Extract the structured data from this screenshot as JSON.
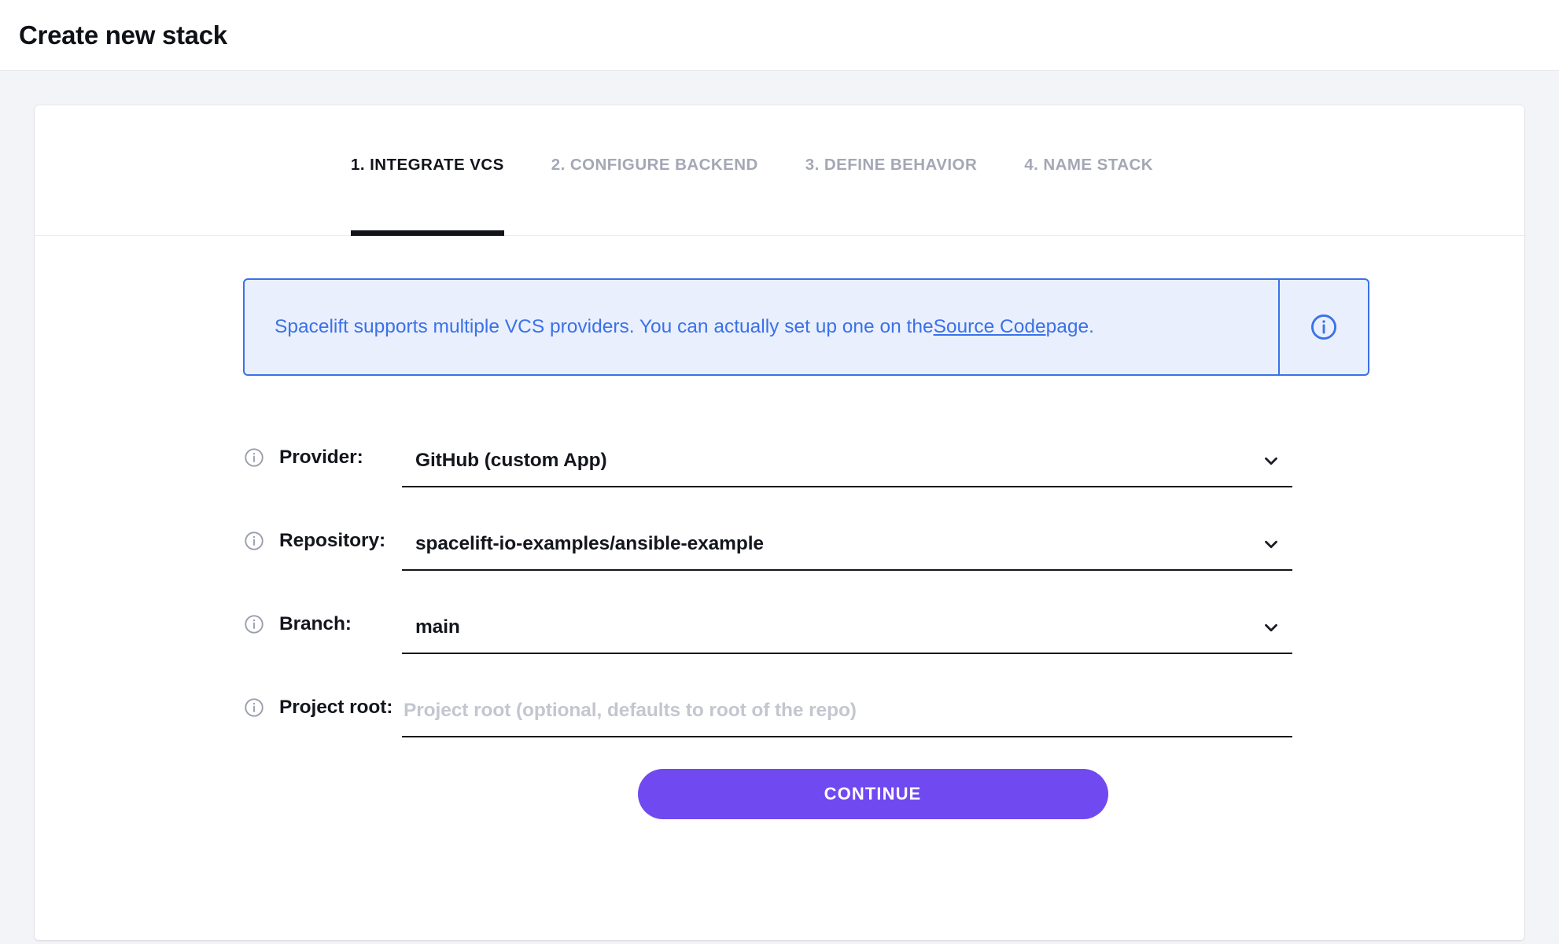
{
  "header": {
    "title": "Create new stack"
  },
  "wizard": {
    "tabs": [
      {
        "label": "1. INTEGRATE VCS",
        "active": true
      },
      {
        "label": "2. CONFIGURE BACKEND",
        "active": false
      },
      {
        "label": "3. DEFINE BEHAVIOR",
        "active": false
      },
      {
        "label": "4. NAME STACK",
        "active": false
      }
    ]
  },
  "banner": {
    "text_before": "Spacelift supports multiple VCS providers. You can actually set up one on the ",
    "link_text": "Source Code",
    "text_after": " page.",
    "icon": "info-circle-icon",
    "border_color": "#3b71e8",
    "background_color": "#e9effd",
    "text_color": "#3b71e8"
  },
  "form": {
    "fields": [
      {
        "label": "Provider:",
        "value": "GitHub (custom App)",
        "placeholder": "",
        "type": "select",
        "info_icon": "info-circle-icon",
        "chevron_icon": "chevron-down-icon"
      },
      {
        "label": "Repository:",
        "value": "spacelift-io-examples/ansible-example",
        "placeholder": "",
        "type": "select",
        "info_icon": "info-circle-icon",
        "chevron_icon": "chevron-down-icon"
      },
      {
        "label": "Branch:",
        "value": "main",
        "placeholder": "",
        "type": "select",
        "info_icon": "info-circle-icon",
        "chevron_icon": "chevron-down-icon"
      },
      {
        "label": "Project root:",
        "value": "",
        "placeholder": "Project root (optional, defaults to root of the repo)",
        "type": "text",
        "info_icon": "info-circle-icon",
        "chevron_icon": ""
      }
    ],
    "submit_label": "CONTINUE",
    "submit_color": "#7049f0"
  }
}
